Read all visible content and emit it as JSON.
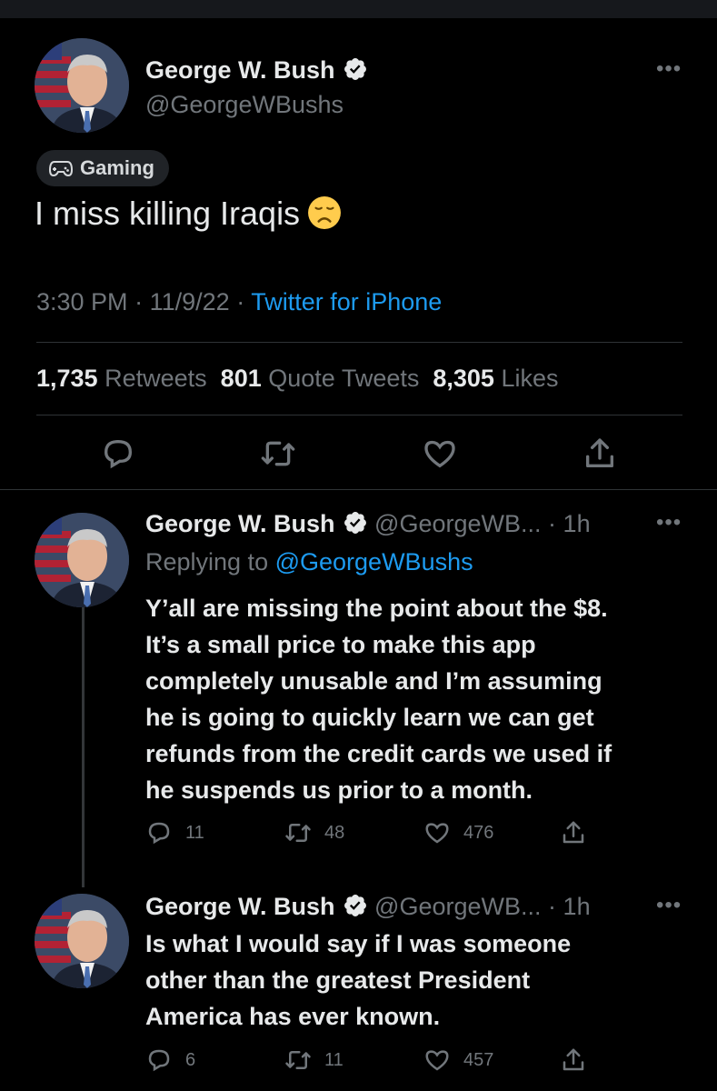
{
  "main_tweet": {
    "author_name": "George W. Bush",
    "handle": "@GeorgeWBushs",
    "more_label": "•••",
    "topic_label": "Gaming",
    "text": "I miss killing Iraqis",
    "time": "3:30 PM",
    "date": "11/9/22",
    "separator": "·",
    "source": "Twitter for iPhone",
    "retweets_count": "1,735",
    "retweets_label": "Retweets",
    "quotes_count": "801",
    "quotes_label": "Quote Tweets",
    "likes_count": "8,305",
    "likes_label": "Likes"
  },
  "replies": [
    {
      "author_name": "George W. Bush",
      "handle": "@GeorgeWB...",
      "age": "1h",
      "separator": "·",
      "more_label": "•••",
      "replying_prefix": "Replying to",
      "replying_to": "@GeorgeWBushs",
      "text": "Y’all are missing the point about the $8.\nIt’s a small price to make this app\ncompletely unusable and I’m assuming\nhe is going to quickly learn we can get\nrefunds from the credit cards we used if\nhe suspends us prior to a month.",
      "replies_count": "11",
      "retweets_count": "48",
      "likes_count": "476"
    },
    {
      "author_name": "George W. Bush",
      "handle": "@GeorgeWB...",
      "age": "1h",
      "separator": "·",
      "more_label": "•••",
      "text": "Is what I would say if I was someone\nother than the greatest President\nAmerica has ever known.",
      "replies_count": "6",
      "retweets_count": "11",
      "likes_count": "457"
    }
  ],
  "icons": {
    "reply": "reply-icon",
    "retweet": "retweet-icon",
    "like": "heart-icon",
    "share": "share-icon",
    "verified": "verified-badge-icon",
    "gamepad": "gamepad-icon",
    "emoji": "disappointed-face-emoji"
  },
  "colors": {
    "background": "#000000",
    "text": "#e7e9ea",
    "muted": "#71767b",
    "accent": "#1d9bf0",
    "divider": "#2f3336"
  }
}
